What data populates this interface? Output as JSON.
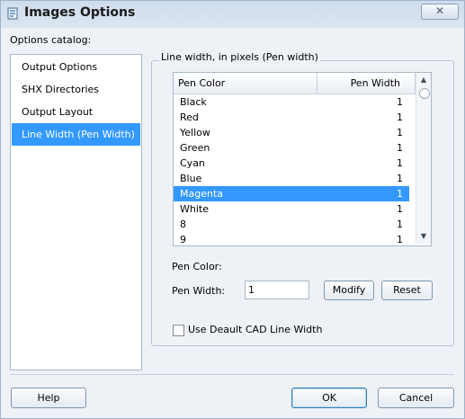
{
  "window": {
    "title": "Images Options",
    "close_label": "✕"
  },
  "catalog": {
    "label": "Options catalog:",
    "items": [
      {
        "label": "Output Options",
        "selected": false
      },
      {
        "label": "SHX Directories",
        "selected": false
      },
      {
        "label": "Output Layout",
        "selected": false
      },
      {
        "label": "Line Width (Pen Width)",
        "selected": true
      }
    ]
  },
  "line_width": {
    "group_title": "Line width, in pixels (Pen width)",
    "columns": [
      "Pen Color",
      "Pen Width"
    ],
    "rows": [
      {
        "name": "Black",
        "width": "1"
      },
      {
        "name": "Red",
        "width": "1"
      },
      {
        "name": "Yellow",
        "width": "1"
      },
      {
        "name": "Green",
        "width": "1"
      },
      {
        "name": "Cyan",
        "width": "1"
      },
      {
        "name": "Blue",
        "width": "1"
      },
      {
        "name": "Magenta",
        "width": "1",
        "selected": true
      },
      {
        "name": "White",
        "width": "1"
      },
      {
        "name": "8",
        "width": "1"
      },
      {
        "name": "9",
        "width": "1"
      }
    ],
    "pen_color_label": "Pen Color:",
    "pen_width_label": "Pen Width:",
    "pen_width_value": "1",
    "modify_label": "Modify",
    "reset_label": "Reset",
    "checkbox_label": "Use Deault CAD Line Width",
    "checkbox_checked": false
  },
  "footer": {
    "help_label": "Help",
    "ok_label": "OK",
    "cancel_label": "Cancel"
  },
  "colors": {
    "selection": "#3399ff",
    "window_bg": "#eef2f7"
  }
}
